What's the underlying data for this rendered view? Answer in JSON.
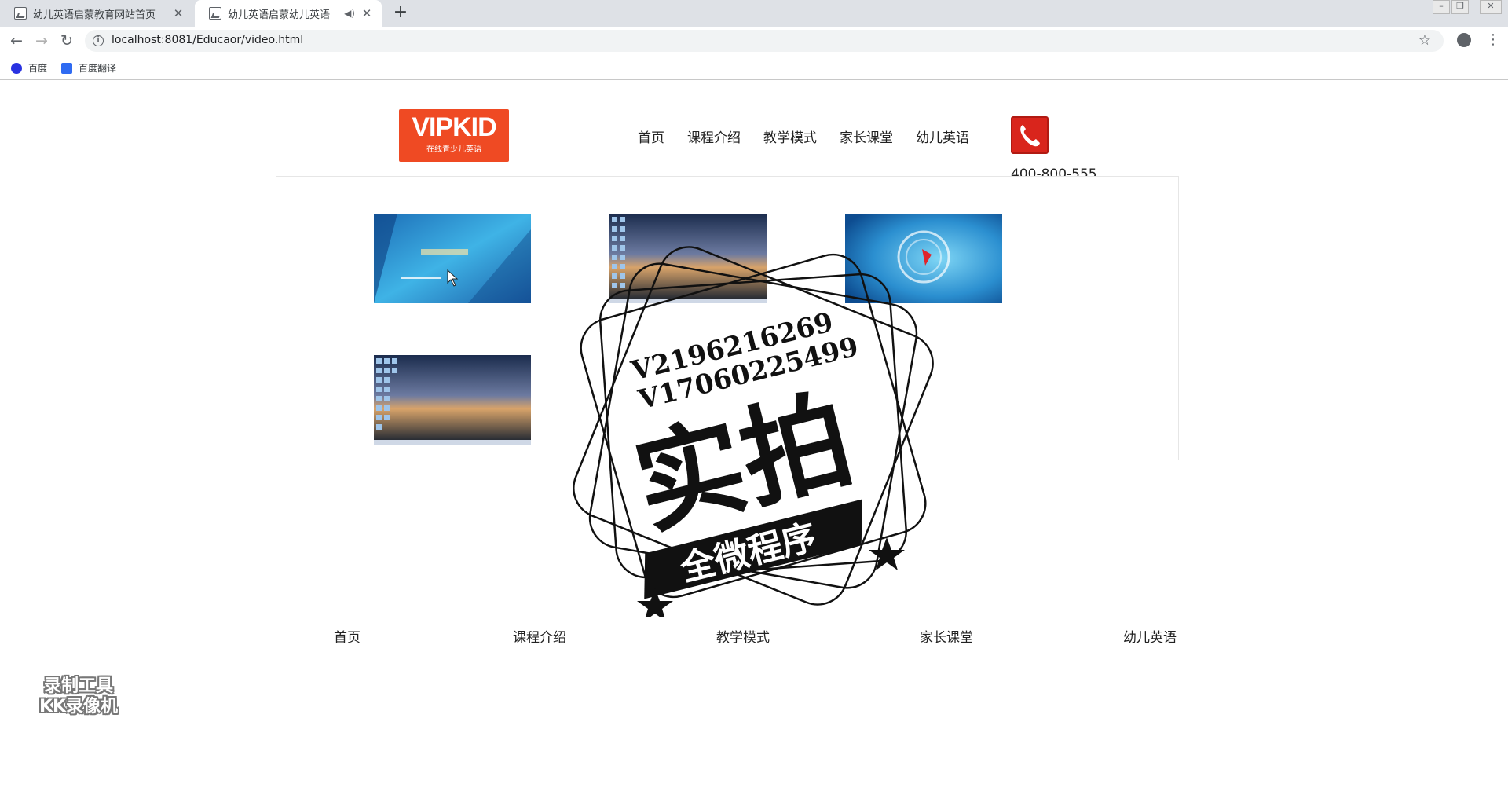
{
  "browser": {
    "tabs": [
      {
        "title": "幼儿英语启蒙教育网站首页",
        "active": false
      },
      {
        "title": "幼儿英语启蒙幼儿英语",
        "active": true
      }
    ],
    "new_tab": "+",
    "url": "localhost:8081/Educaor/video.html",
    "bookmarks": [
      {
        "label": "百度",
        "icon": "baidu-paw-icon",
        "color": "#2932e1"
      },
      {
        "label": "百度翻译",
        "icon": "translate-icon",
        "color": "#2f6bf2"
      }
    ]
  },
  "header": {
    "logo": {
      "brand": "VIPKID",
      "slogan": "在线青少儿英语",
      "color": "#ef4a23"
    },
    "nav": [
      "首页",
      "课程介绍",
      "教学模式",
      "家长课堂",
      "幼儿英语"
    ],
    "phone": {
      "icon": "phone-icon",
      "number": "400-800-555",
      "color": "#d9251c"
    }
  },
  "videos": [
    {
      "name": "video-thumbnail-1",
      "style": "blue-intro"
    },
    {
      "name": "video-thumbnail-2",
      "style": "desktop-sunset"
    },
    {
      "name": "video-thumbnail-3",
      "style": "blue-logo"
    },
    {
      "name": "video-thumbnail-4",
      "style": "desktop-sunset"
    }
  ],
  "footer_nav": [
    "首页",
    "课程介绍",
    "教学模式",
    "家长课堂",
    "幼儿英语"
  ],
  "overlays": {
    "stamp": {
      "line1": "V2196216269",
      "line2": "V17060225499",
      "main": "实拍",
      "banner": "全微程序"
    },
    "recorder": {
      "line1": "录制工具",
      "line2": "KK录像机"
    }
  }
}
